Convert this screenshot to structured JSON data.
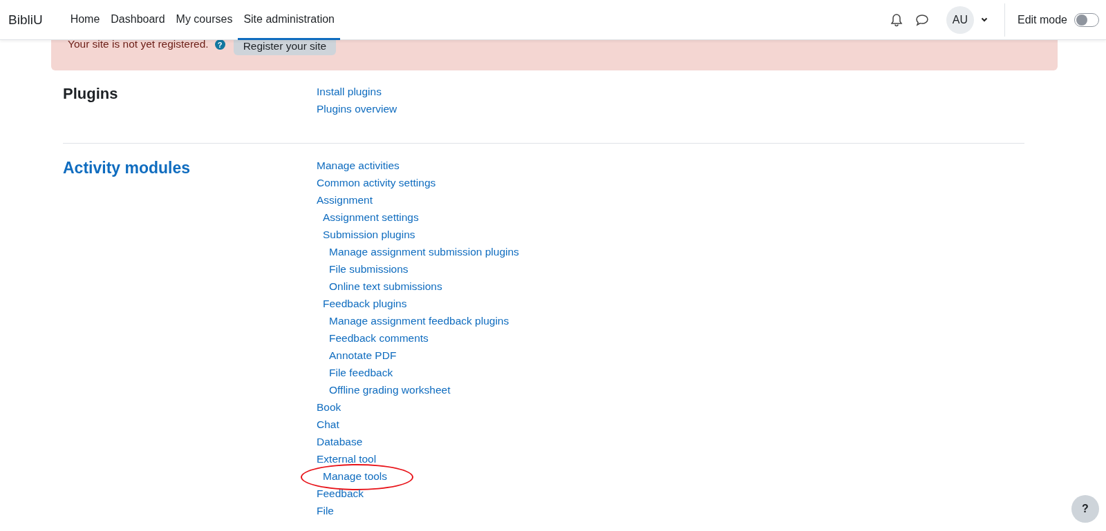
{
  "navbar": {
    "brand": "BibliU",
    "links": [
      {
        "label": "Home",
        "selected": false
      },
      {
        "label": "Dashboard",
        "selected": false
      },
      {
        "label": "My courses",
        "selected": false
      },
      {
        "label": "Site administration",
        "selected": true
      }
    ],
    "user": {
      "initials": "AU"
    },
    "edit_mode": {
      "label": "Edit mode",
      "on": false
    }
  },
  "alert": {
    "message": "Your site is not yet registered.",
    "help_icon": "?",
    "button": "Register your site"
  },
  "sections": [
    {
      "heading": "Plugins",
      "linked": false,
      "items": [
        {
          "label": "Install plugins",
          "circled": false
        },
        {
          "label": "Plugins overview",
          "circled": false
        }
      ]
    },
    {
      "heading": "Activity modules",
      "linked": true,
      "items": [
        {
          "label": "Manage activities",
          "circled": false
        },
        {
          "label": "Common activity settings",
          "circled": false
        },
        {
          "label": "Assignment",
          "circled": false,
          "children": [
            {
              "label": "Assignment settings",
              "circled": false
            },
            {
              "label": "Submission plugins",
              "circled": false,
              "children": [
                {
                  "label": "Manage assignment submission plugins",
                  "circled": false
                },
                {
                  "label": "File submissions",
                  "circled": false
                },
                {
                  "label": "Online text submissions",
                  "circled": false
                }
              ]
            },
            {
              "label": "Feedback plugins",
              "circled": false,
              "children": [
                {
                  "label": "Manage assignment feedback plugins",
                  "circled": false
                },
                {
                  "label": "Feedback comments",
                  "circled": false
                },
                {
                  "label": "Annotate PDF",
                  "circled": false
                },
                {
                  "label": "File feedback",
                  "circled": false
                },
                {
                  "label": "Offline grading worksheet",
                  "circled": false
                }
              ]
            }
          ]
        },
        {
          "label": "Book",
          "circled": false
        },
        {
          "label": "Chat",
          "circled": false
        },
        {
          "label": "Database",
          "circled": false
        },
        {
          "label": "External tool",
          "circled": false,
          "children": [
            {
              "label": "Manage tools",
              "circled": true
            }
          ]
        },
        {
          "label": "Feedback",
          "circled": false
        },
        {
          "label": "File",
          "circled": false
        }
      ]
    }
  ],
  "help_button": {
    "label": "?"
  }
}
